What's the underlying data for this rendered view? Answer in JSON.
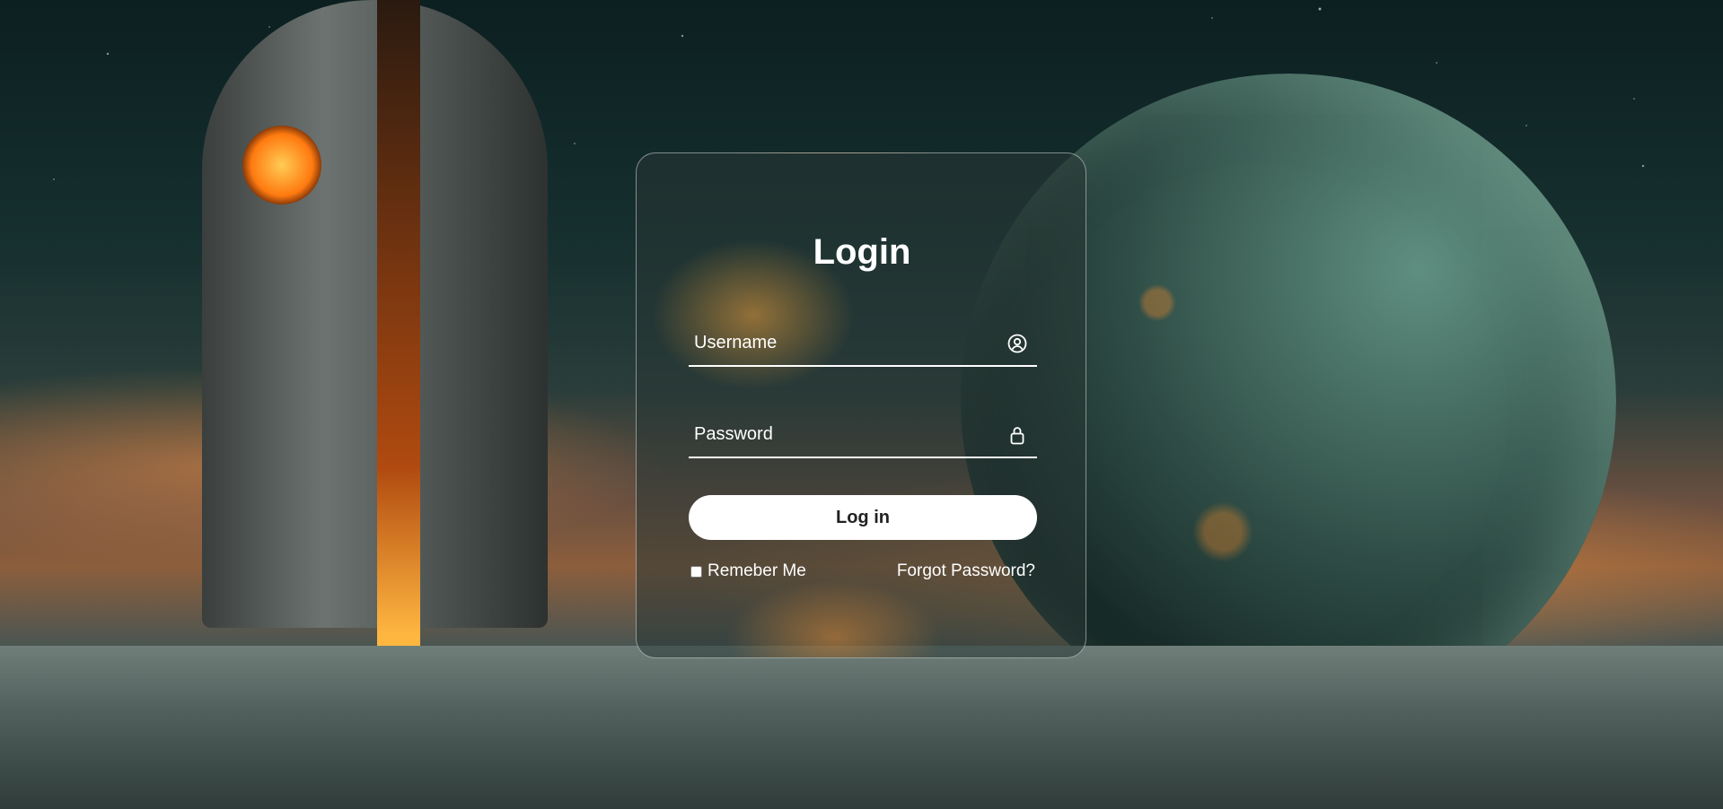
{
  "background": {
    "scene": "sci-fi planet landscape"
  },
  "login_form": {
    "title": "Login",
    "username": {
      "placeholder": "Username",
      "value": "",
      "icon": "user-circle-icon"
    },
    "password": {
      "placeholder": "Password",
      "value": "",
      "icon": "lock-icon"
    },
    "submit_label": "Log in",
    "remember_label": "Remeber Me",
    "remember_checked": false,
    "forgot_label": "Forgot Password?"
  },
  "colors": {
    "panel_border": "#ffffff",
    "button_bg": "#ffffff",
    "button_text": "#222222",
    "text": "#ffffff"
  }
}
